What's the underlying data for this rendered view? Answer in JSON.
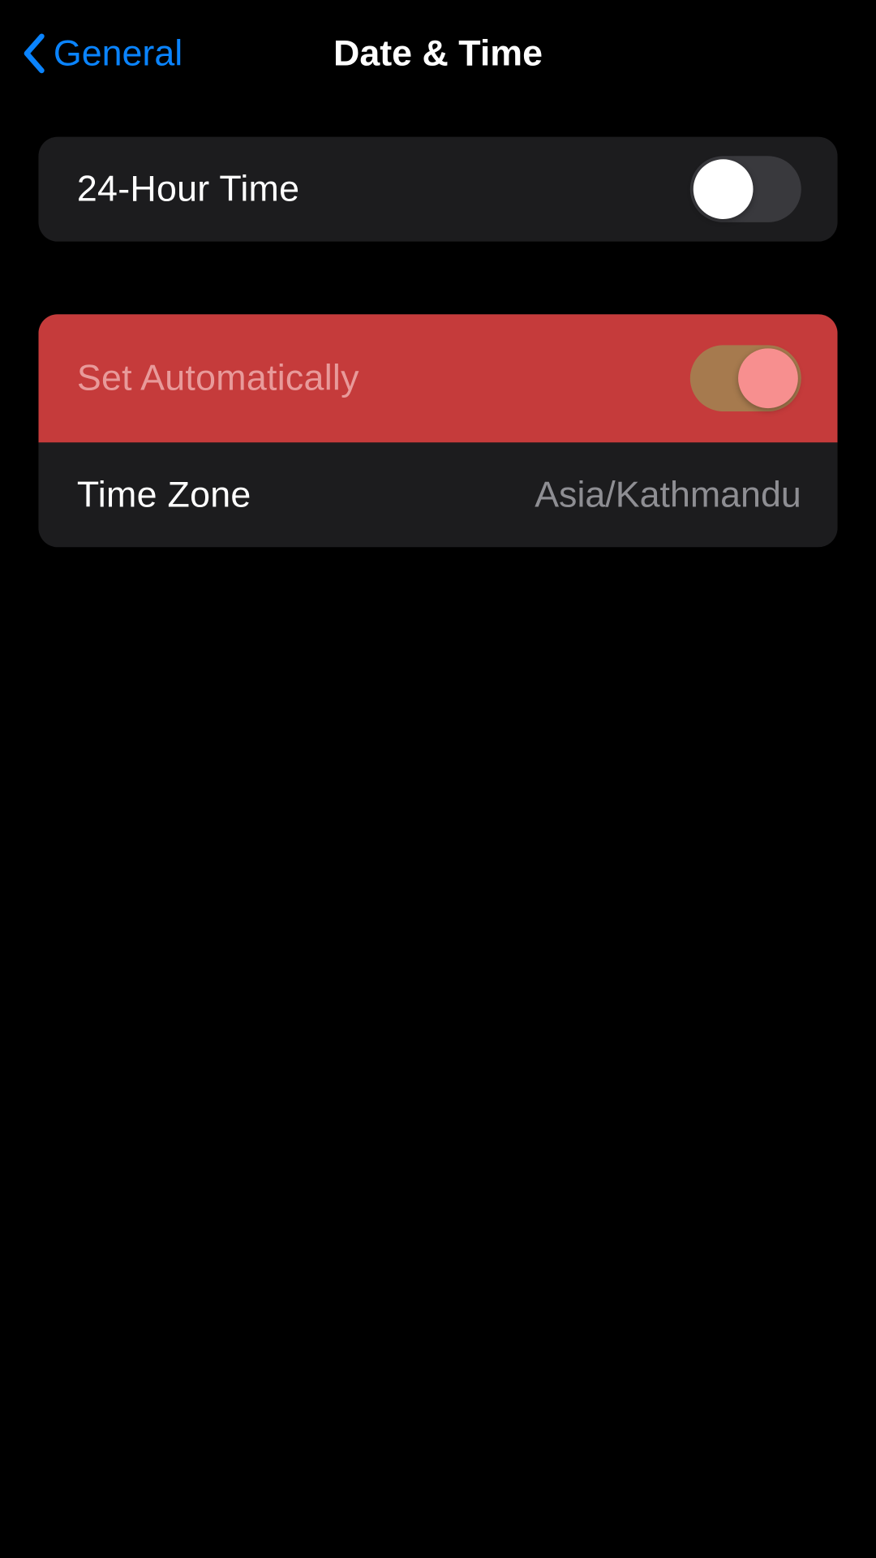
{
  "nav": {
    "back_label": "General",
    "title": "Date & Time"
  },
  "group1": {
    "twenty_four_hour": {
      "label": "24-Hour Time",
      "on": false
    }
  },
  "group2": {
    "set_automatically": {
      "label": "Set Automatically",
      "on": true,
      "highlighted": true
    },
    "time_zone": {
      "label": "Time Zone",
      "value": "Asia/Kathmandu"
    }
  },
  "colors": {
    "accent": "#0a84ff",
    "highlight_bg": "#c53b3b"
  }
}
